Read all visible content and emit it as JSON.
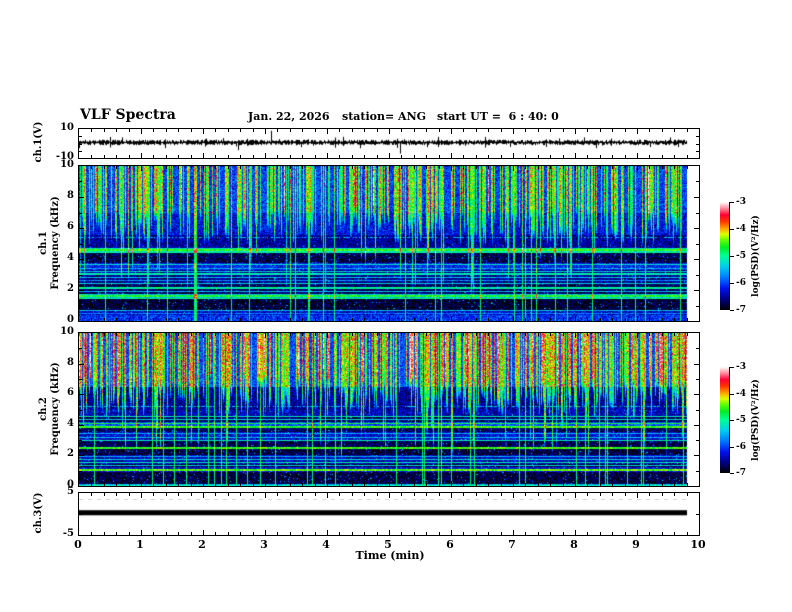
{
  "header": {
    "title": "VLF Spectra",
    "date": "Jan. 22, 2026",
    "station": "station= ANG",
    "start_ut": "start UT =  6 : 40: 0"
  },
  "x_axis": {
    "label": "Time (min)",
    "range": [
      0,
      10
    ],
    "ticks": [
      0,
      1,
      2,
      3,
      4,
      5,
      6,
      7,
      8,
      9,
      10
    ],
    "minor_step": 0.2
  },
  "panels": [
    {
      "id": "ch1-voltage",
      "ylabel": "ch.1(V)",
      "ylim": [
        -10,
        10
      ],
      "yticks_major": [
        10,
        -10
      ],
      "yticks_minor": [
        -5,
        0,
        5
      ]
    },
    {
      "id": "ch1-spectrogram",
      "ylabel": "ch.1\nFrequency (kHz)",
      "ylim": [
        0,
        10
      ],
      "yticks_major": [
        0,
        2,
        4,
        6,
        8,
        10
      ],
      "yticks_minor": [
        1,
        3,
        5,
        7,
        9
      ]
    },
    {
      "id": "ch2-spectrogram",
      "ylabel": "ch.2\nFrequency (kHz)",
      "ylim": [
        0,
        10
      ],
      "yticks_major": [
        0,
        2,
        4,
        6,
        8,
        10
      ],
      "yticks_minor": [
        1,
        3,
        5,
        7,
        9
      ]
    },
    {
      "id": "ch3-voltage",
      "ylabel": "ch.3(V)",
      "ylim": [
        -5,
        5
      ],
      "yticks_major": [
        5,
        -5
      ],
      "yticks_minor": [
        0
      ]
    }
  ],
  "colorbar": {
    "label": "log(PSD)(V²/Hz)",
    "range": [
      -7,
      -3
    ],
    "ticks": [
      -3,
      -4,
      -5,
      -6,
      -7
    ],
    "stops": [
      [
        0,
        "#000000"
      ],
      [
        0.1,
        "#000080"
      ],
      [
        0.2,
        "#0011ee"
      ],
      [
        0.3,
        "#0077ff"
      ],
      [
        0.4,
        "#00ccee"
      ],
      [
        0.5,
        "#00ff99"
      ],
      [
        0.58,
        "#00ee22"
      ],
      [
        0.65,
        "#66ff00"
      ],
      [
        0.7,
        "#ddff00"
      ],
      [
        0.75,
        "#ffaa00"
      ],
      [
        0.82,
        "#ff3300"
      ],
      [
        0.88,
        "#ff0033"
      ],
      [
        0.94,
        "#ff8899"
      ],
      [
        1,
        "#ffffff"
      ]
    ]
  },
  "chart_data": [
    {
      "type": "line",
      "panel": "ch1-voltage",
      "title": "ch.1(V) waveform",
      "x_range": [
        0,
        9.8
      ],
      "ylim": [
        -10,
        10
      ],
      "baseline": 0.7,
      "noise_amp": 1.6,
      "seed": 7,
      "spikes": [
        [
          0.7,
          4.2
        ],
        [
          2.05,
          3.4
        ],
        [
          2.56,
          -4.6
        ],
        [
          3.1,
          8.8
        ],
        [
          3.22,
          3.0
        ],
        [
          4.02,
          2.6
        ],
        [
          5.18,
          -7.0
        ],
        [
          5.24,
          3.0
        ],
        [
          5.55,
          2.3
        ],
        [
          6.85,
          2.2
        ],
        [
          8.05,
          1.9
        ]
      ]
    },
    {
      "type": "heatmap",
      "panel": "ch1-spectrogram",
      "title": "ch.1 spectrogram",
      "x_range": [
        0,
        9.8
      ],
      "ylim": [
        0,
        10
      ],
      "z_range": [
        -7,
        -3
      ],
      "seed": 42,
      "bands": [
        [
          0,
          0.45,
          -6.1
        ],
        [
          0.45,
          0.75,
          -6.35
        ],
        [
          0.75,
          1.45,
          -6.85
        ],
        [
          1.45,
          1.75,
          -5.4
        ],
        [
          1.75,
          2.45,
          -6.7
        ],
        [
          2.45,
          3.35,
          -6.55
        ],
        [
          3.35,
          3.75,
          -6.15
        ],
        [
          3.75,
          4.45,
          -6.75
        ],
        [
          4.45,
          4.75,
          -5.15
        ],
        [
          4.75,
          5.6,
          -6.5
        ],
        [
          5.6,
          7,
          -6.25
        ],
        [
          7,
          10,
          -6.0
        ]
      ],
      "h_lines": [
        [
          5.45,
          -5.6,
          1,
          0.5
        ],
        [
          4.6,
          -4.7,
          2,
          1
        ],
        [
          4.45,
          -5.3,
          1,
          1
        ],
        [
          3.65,
          -5.4,
          1,
          1
        ],
        [
          3.45,
          -5.7,
          1,
          1
        ],
        [
          3.25,
          -5.5,
          1,
          1
        ],
        [
          3.05,
          -5.3,
          2,
          1
        ],
        [
          2.85,
          -5.6,
          1,
          1
        ],
        [
          2.65,
          -5.8,
          1,
          1
        ],
        [
          2.45,
          -5.5,
          1,
          1
        ],
        [
          2.15,
          -5.2,
          2,
          1
        ],
        [
          1.95,
          -5.6,
          1,
          1
        ],
        [
          1.65,
          -4.8,
          2,
          1
        ],
        [
          1.5,
          -5.1,
          1,
          1
        ],
        [
          0.7,
          -5.6,
          1,
          1
        ],
        [
          0.5,
          -5.9,
          1,
          1
        ]
      ],
      "streaks": {
        "prob": 0.55,
        "boost": [
          1.1,
          2.4
        ],
        "depth": [
          4.8,
          6.8
        ],
        "deep_prob": 0.1,
        "full_prob": 0.05,
        "red_prob": 0.015
      }
    },
    {
      "type": "heatmap",
      "panel": "ch2-spectrogram",
      "title": "ch.2 spectrogram",
      "x_range": [
        0,
        9.8
      ],
      "ylim": [
        0,
        10
      ],
      "z_range": [
        -7,
        -3
      ],
      "seed": 99,
      "bands": [
        [
          0,
          0.18,
          -5.5
        ],
        [
          0.18,
          0.95,
          -6.8
        ],
        [
          0.95,
          1.25,
          -6.3
        ],
        [
          1.25,
          1.45,
          -6.8
        ],
        [
          1.45,
          2.05,
          -6.4
        ],
        [
          2.05,
          2.45,
          -6.8
        ],
        [
          2.45,
          2.6,
          -5.9
        ],
        [
          2.6,
          2.95,
          -6.75
        ],
        [
          2.95,
          3.55,
          -6.3
        ],
        [
          3.55,
          3.8,
          -6.7
        ],
        [
          3.8,
          4.2,
          -5.95
        ],
        [
          4.2,
          4.55,
          -6.7
        ],
        [
          4.55,
          5.0,
          -6.4
        ],
        [
          5.0,
          6.5,
          -6.5
        ],
        [
          6.5,
          10,
          -5.95
        ]
      ],
      "h_lines": [
        [
          1.1,
          -4.6,
          2,
          1
        ],
        [
          1.35,
          -5.5,
          1,
          1
        ],
        [
          1.55,
          -5.3,
          1,
          1
        ],
        [
          1.75,
          -5.5,
          1,
          1
        ],
        [
          1.95,
          -5.7,
          1,
          1
        ],
        [
          2.5,
          -4.7,
          2,
          1
        ],
        [
          3.0,
          -5.3,
          1,
          1
        ],
        [
          3.2,
          -5.6,
          1,
          1
        ],
        [
          3.45,
          -5.7,
          1,
          1
        ],
        [
          3.9,
          -4.7,
          2,
          1
        ],
        [
          4.1,
          -4.9,
          1,
          1
        ],
        [
          4.35,
          -5.5,
          1,
          1
        ],
        [
          4.6,
          -5.3,
          1,
          1
        ],
        [
          5.2,
          -5.5,
          1,
          0.5
        ],
        [
          0.08,
          -5.3,
          1,
          1
        ]
      ],
      "streaks": {
        "prob": 0.6,
        "boost": [
          1.3,
          2.7
        ],
        "depth": [
          4.5,
          6.5
        ],
        "deep_prob": 0.12,
        "full_prob": 0.05,
        "red_prob": 0.03
      }
    },
    {
      "type": "line",
      "panel": "ch3-voltage",
      "title": "ch.3(V) flat trace",
      "x_range": [
        0,
        9.8
      ],
      "ylim": [
        -5,
        5
      ],
      "value": 0.3,
      "thickness_volts": 1.2
    }
  ]
}
